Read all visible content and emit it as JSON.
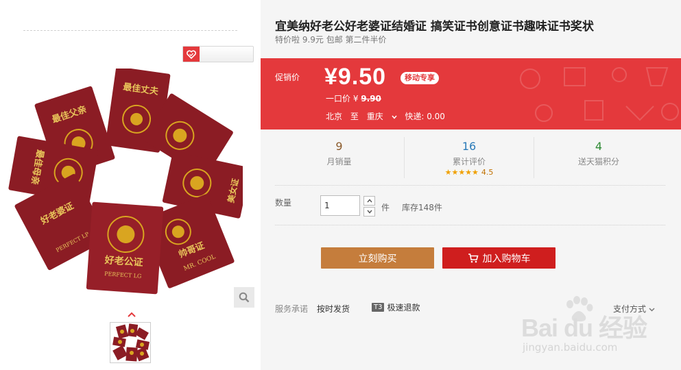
{
  "product": {
    "title": "宜美纳好老公好老婆证结婚证 搞笑证书创意证书趣味证书奖状",
    "subtitle": "特价啦 9.9元 包邮 第二件半价"
  },
  "promo": {
    "label": "促销价",
    "price": "¥9.50",
    "mobile_badge": "移动专享",
    "original_label": "一口价 ¥",
    "original_price": "9.90",
    "ship_from": "北京",
    "ship_to_word": "至",
    "ship_to": "重庆",
    "shipping": "快递: 0.00"
  },
  "stats": [
    {
      "value": "9",
      "caption": "月销量"
    },
    {
      "value": "16",
      "caption": "累计评价",
      "rating": "4.5",
      "stars": "★★★★★"
    },
    {
      "value": "4",
      "caption": "送天猫积分"
    }
  ],
  "quantity": {
    "label": "数量",
    "value": "1",
    "unit": "件",
    "stock": "库存148件"
  },
  "buttons": {
    "buy_now": "立刻购买",
    "add_cart": "加入购物车"
  },
  "services": {
    "label": "服务承诺",
    "item1": "按时发货",
    "item2_badge": "T3",
    "item2": "极速退款",
    "payment": "支付方式"
  },
  "booklets": {
    "b1": "最佳父亲",
    "b2": "最佳丈夫",
    "b3": "最佳母亲",
    "b4": "好老婆证",
    "b5": "好老公证",
    "b6": "帅哥证",
    "b7": "美女证",
    "b8": "好老公证",
    "en5": "PERFECT LG",
    "en4": "PERFECT LP",
    "en6": "MR. COOL"
  },
  "watermark": {
    "brand": "Bai du 经验",
    "url": "jingyan.baidu.com"
  },
  "colors": {
    "accent": "#e4393c",
    "buy_now": "#c57d3c",
    "add_cart": "#cf1e1e",
    "booklet": "#8b1c24",
    "gold": "#d9a520"
  }
}
